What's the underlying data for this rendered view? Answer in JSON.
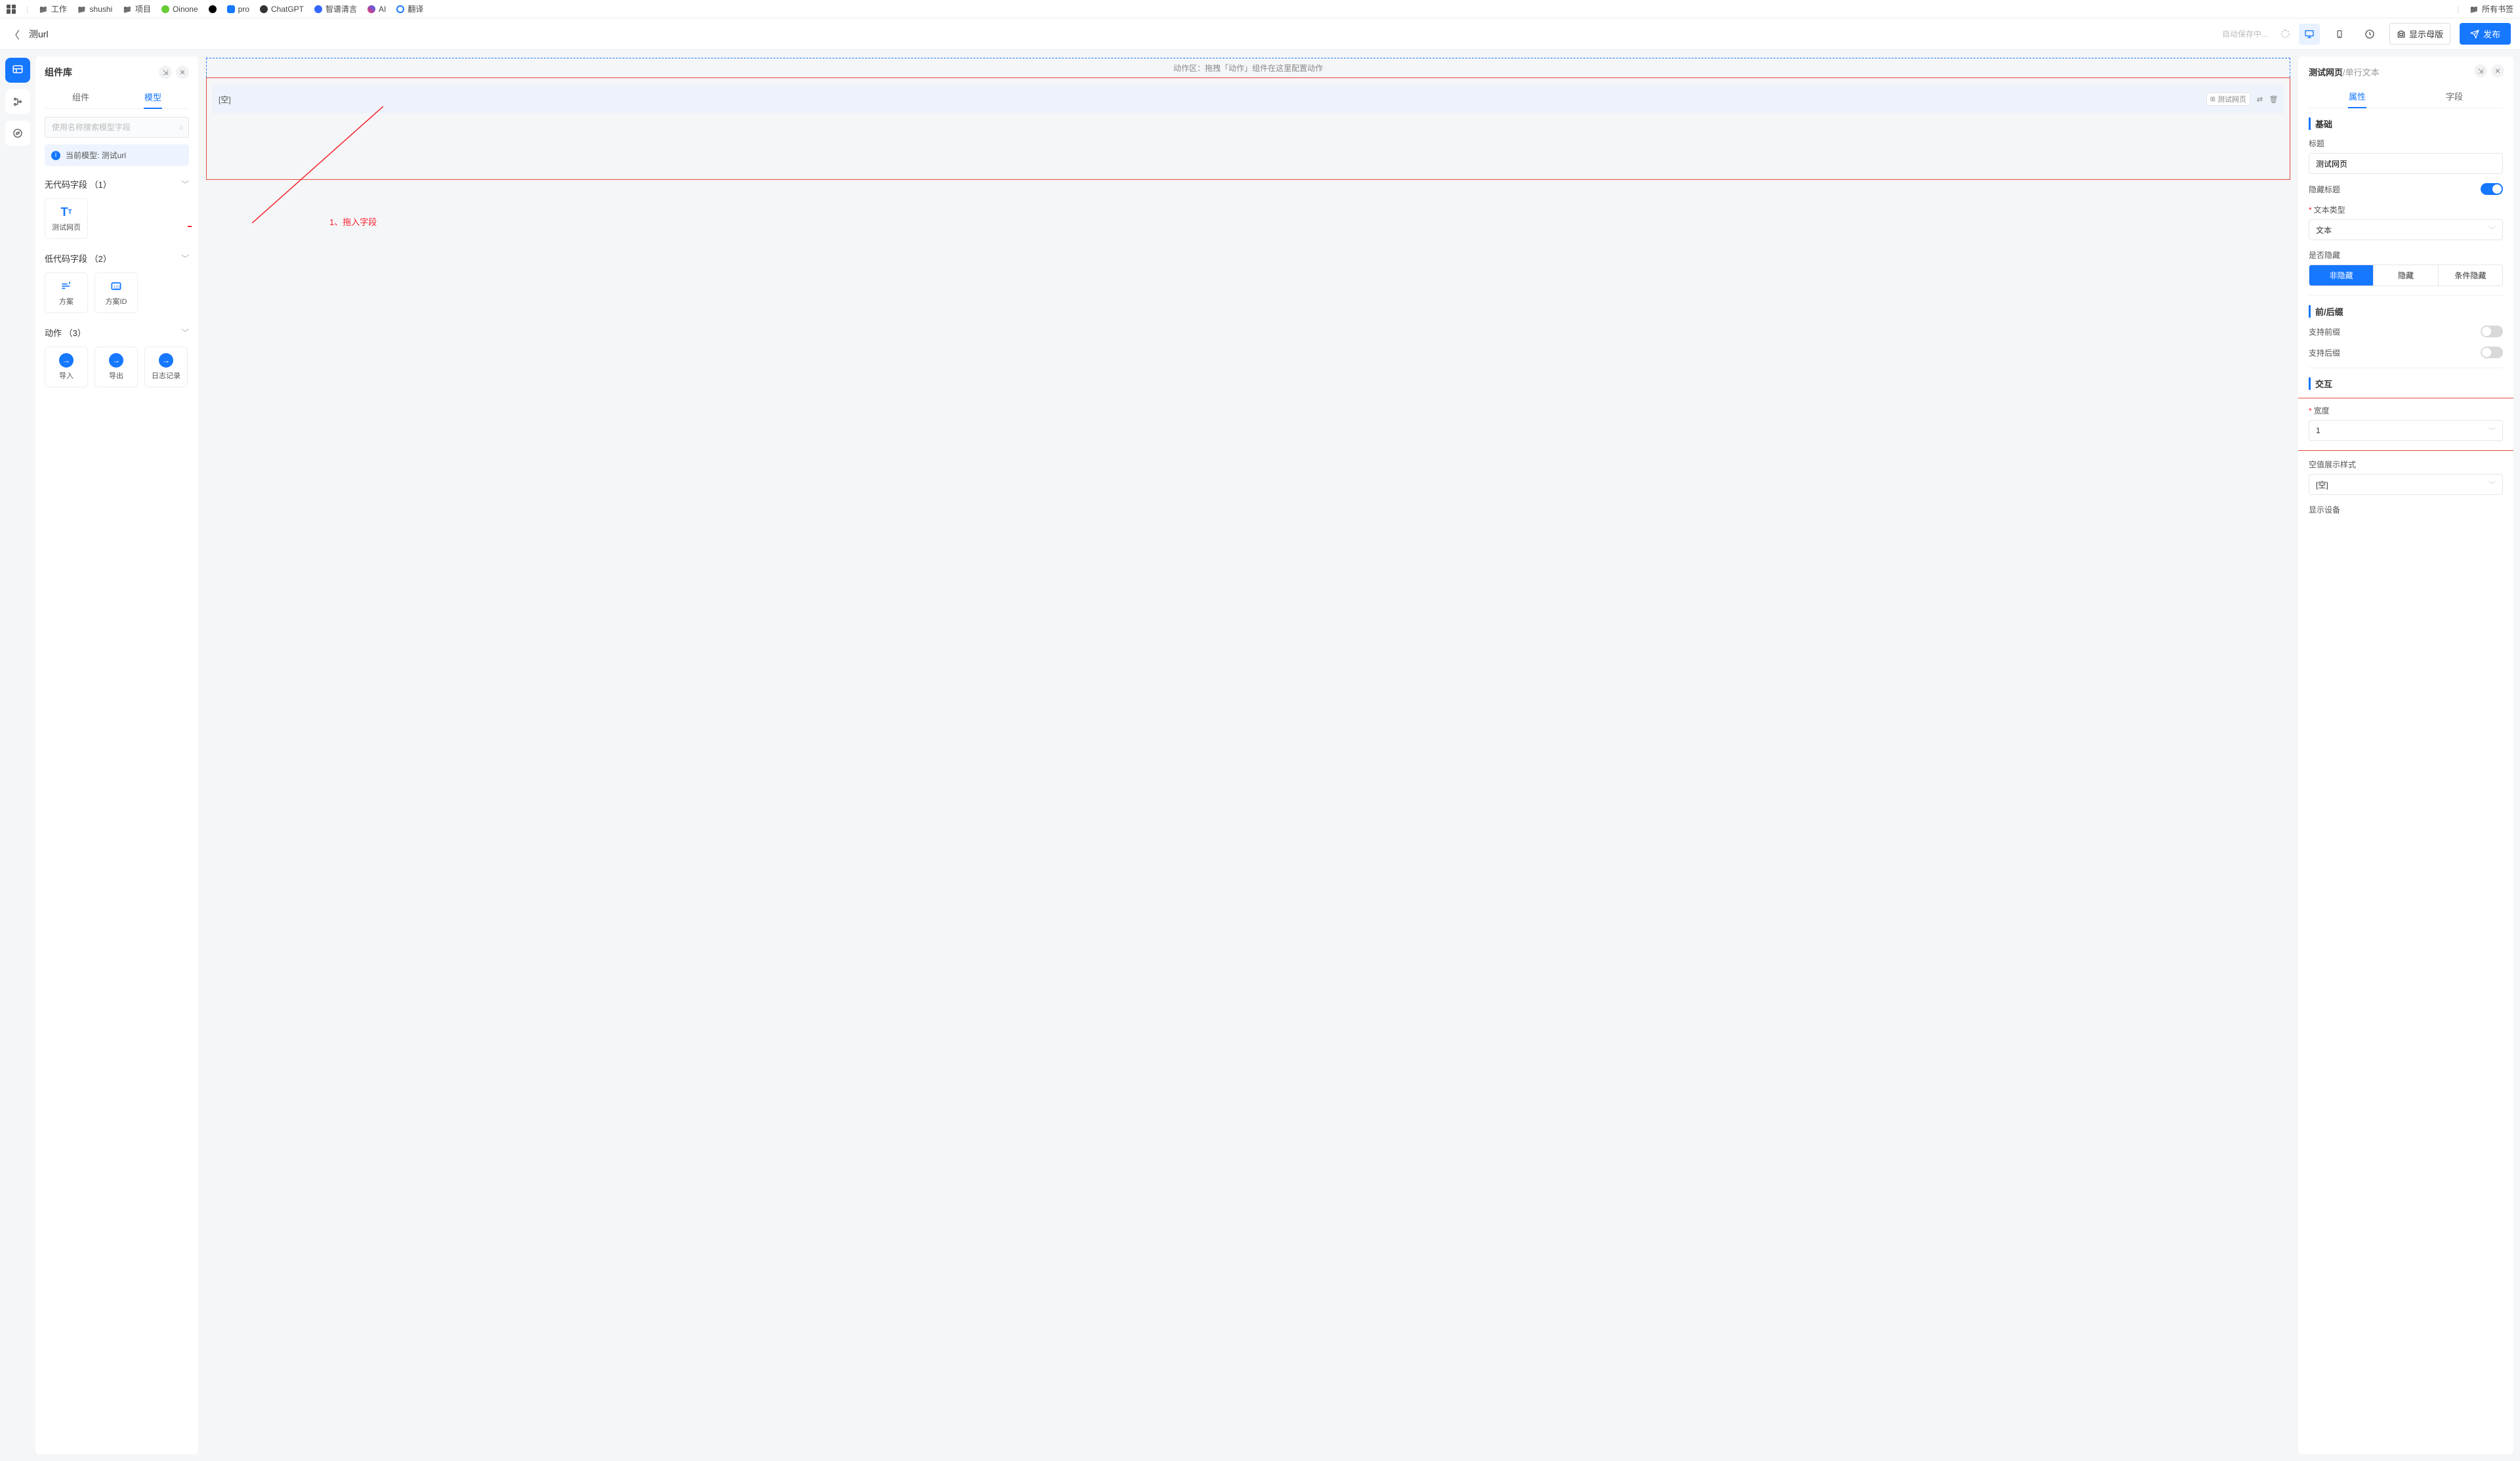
{
  "bookmarks": {
    "items": [
      "工作",
      "shushi",
      "项目",
      "Oinone",
      "",
      "pro",
      "ChatGPT",
      "智谱清言",
      "AI",
      "翻译"
    ],
    "all": "所有书签"
  },
  "titlebar": {
    "title": "测url",
    "autosave": "自动保存中...",
    "show_master": "显示母版",
    "publish": "发布"
  },
  "left": {
    "header": "组件库",
    "tab_component": "组件",
    "tab_model": "模型",
    "search_placeholder": "使用名称搜索模型字段",
    "current_model": "当前模型: 测试url",
    "group_nocode": "无代码字段 （1）",
    "card_test_page": "测试网页",
    "group_lowcode": "低代码字段 （2）",
    "card_plan": "方案",
    "card_plan_id": "方案ID",
    "group_actions": "动作 （3）",
    "card_import": "导入",
    "card_export": "导出",
    "card_log": "日志记录"
  },
  "canvas": {
    "action_zone": "动作区：拖拽「动作」组件在这里配置动作",
    "field_placeholder": "[空]",
    "field_tag": "测试网页",
    "annotation": "1、拖入字段"
  },
  "right": {
    "bc_a": "测试网页",
    "bc_b": "/单行文本",
    "tab_props": "属性",
    "tab_field": "字段",
    "sec_basic": "基础",
    "label_title": "标题",
    "input_title_value": "测试网页",
    "label_hide_title": "隐藏标题",
    "label_text_type": "文本类型",
    "select_text_type_value": "文本",
    "label_is_hidden": "是否隐藏",
    "seg_not_hidden": "非隐藏",
    "seg_hidden": "隐藏",
    "seg_cond_hidden": "条件隐藏",
    "sec_affix": "前/后缀",
    "label_prefix": "支持前缀",
    "label_suffix": "支持后缀",
    "sec_interact": "交互",
    "label_width": "宽度",
    "select_width_value": "1",
    "label_empty_style": "空值展示样式",
    "select_empty_value": "[空]",
    "label_display_device": "显示设备"
  }
}
